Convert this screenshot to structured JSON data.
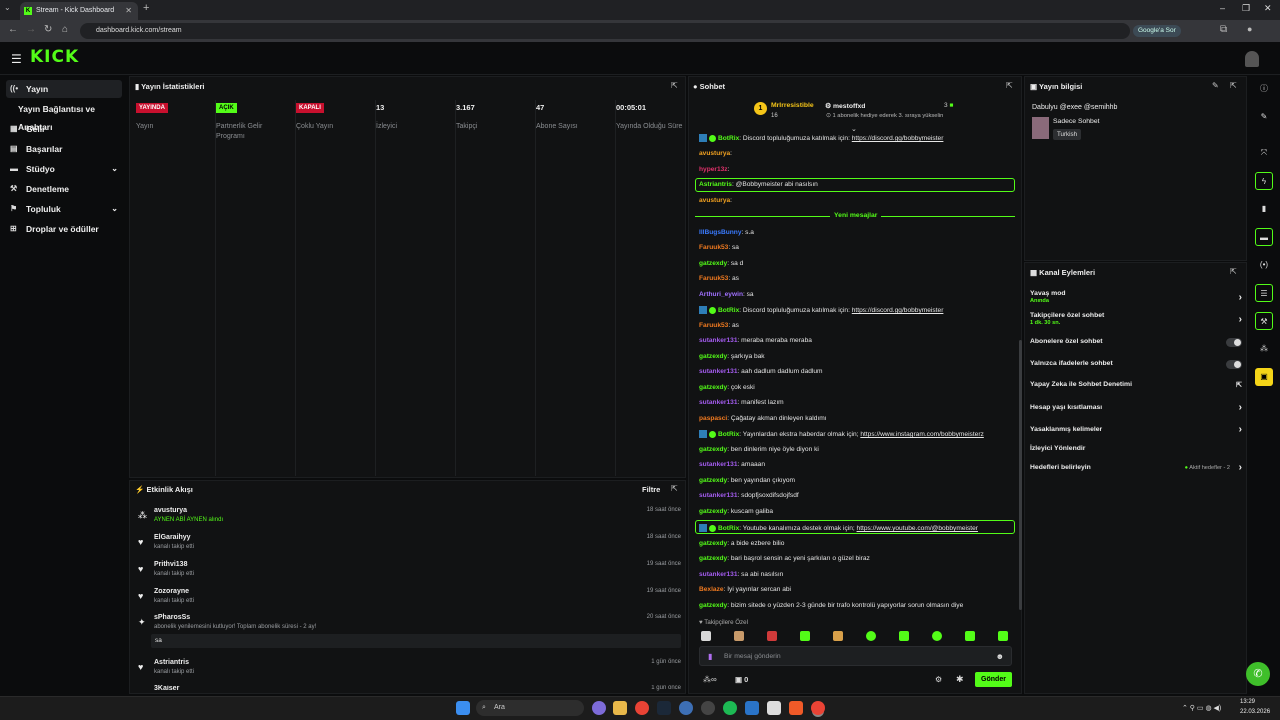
{
  "browser": {
    "tab_title": "Stream - Kick Dashboard",
    "url": "dashboard.kick.com/stream",
    "google_button": "Google'a Sor"
  },
  "app": {
    "logo": "KICK"
  },
  "sidebar": {
    "items": [
      {
        "label": "Yayın",
        "icon": "broadcast-icon"
      },
      {
        "label": "Yayın Bağlantısı ve Anahtarı",
        "icon": ""
      },
      {
        "label": "Gelir",
        "icon": "revenue-icon"
      },
      {
        "label": "Başarılar",
        "icon": "achievements-icon"
      },
      {
        "label": "Stüdyo",
        "icon": "studio-icon"
      },
      {
        "label": "Denetleme",
        "icon": "moderation-icon"
      },
      {
        "label": "Topluluk",
        "icon": "community-icon"
      },
      {
        "label": "Droplar ve ödüller",
        "icon": "drops-icon"
      }
    ]
  },
  "stats": {
    "title": "Yayın İstatistikleri",
    "items": [
      {
        "badge": "YAYINDA",
        "label": "Yayın",
        "color": "#c8102e"
      },
      {
        "badge": "AÇIK",
        "label": "Partnerlik Gelir Programı",
        "color": "#53fc18"
      },
      {
        "badge": "KAPALI",
        "label": "Çoklu Yayın",
        "color": "#c8102e"
      },
      {
        "value": "13",
        "label": "İzleyici"
      },
      {
        "value": "3.167",
        "label": "Takipçi"
      },
      {
        "value": "47",
        "label": "Abone Sayısı"
      },
      {
        "value": "00:05:01",
        "label": "Yayında Olduğu Süre"
      }
    ]
  },
  "activity": {
    "title": "Etkinlik Akışı",
    "filter": "Filtre",
    "items": [
      {
        "name": "avusturya",
        "sub": "AYNEN ABİ AYNEN alındı",
        "time": "18 saat önce"
      },
      {
        "name": "ElGaraihyy",
        "sub": "kanalı takip etti",
        "time": "18 saat önce"
      },
      {
        "name": "Prithvi138",
        "sub": "kanalı takip etti",
        "time": "19 saat önce"
      },
      {
        "name": "Zozorayne",
        "sub": "kanalı takip etti",
        "time": "19 saat önce"
      },
      {
        "name": "sPharosSs",
        "sub": "abonelik yenilemesini kutluyor! Toplam abonelik süresi - 2 ay!",
        "time": "20 saat önce",
        "msg": "sa"
      },
      {
        "name": "Astriantris",
        "sub": "kanalı takip etti",
        "time": "1 gün önce"
      },
      {
        "name": "3Kaiser",
        "sub": "",
        "time": "1 gün önce"
      }
    ]
  },
  "chat": {
    "title": "Sohbet",
    "pinned_user_1": "MrIrresistible",
    "pinned_count_1": "16",
    "pinned_user_2": "mestoffxd",
    "pinned_count_2": "3",
    "pinned_notice": "1 abonelik hediye ederek 3. sıraya yükselin",
    "new_messages": "Yeni mesajlar",
    "messages": [
      {
        "user": "BotRix",
        "color": "#53fc18",
        "text": ": Discord topluluğumuza katılmak için: ",
        "link": "https://discord.gg/bobbymeister"
      },
      {
        "user": "avusturya",
        "color": "#f0a020",
        "text": ":"
      },
      {
        "user": "hyper13z",
        "color": "#e0316b",
        "text": ":"
      },
      {
        "user": "Astriantris",
        "color": "#53fc18",
        "text": ": @Bobbymeister abi nasılsın"
      },
      {
        "user": "avusturya",
        "color": "#f0a020",
        "text": ":"
      },
      {
        "user": "IllBugsBunny",
        "color": "#3a7bff",
        "text": ": s.a"
      },
      {
        "user": "Faruuk53",
        "color": "#f07a20",
        "text": ": sa"
      },
      {
        "user": "gatzexdy",
        "color": "#53fc18",
        "text": ": sa d"
      },
      {
        "user": "Faruuk53",
        "color": "#f07a20",
        "text": ": as"
      },
      {
        "user": "Arthuri_eywin",
        "color": "#a070ff",
        "text": ": sa"
      },
      {
        "user": "BotRix",
        "color": "#53fc18",
        "text": ": Discord topluluğumuza katılmak için: ",
        "link": "https://discord.gg/bobbymeister"
      },
      {
        "user": "Faruuk53",
        "color": "#f07a20",
        "text": ": as"
      },
      {
        "user": "sutanker131",
        "color": "#a45cf0",
        "text": ": meraba meraba meraba"
      },
      {
        "user": "gatzexdy",
        "color": "#53fc18",
        "text": ": şarkıya bak"
      },
      {
        "user": "sutanker131",
        "color": "#a45cf0",
        "text": ": aah dadlum dadlum dadlum"
      },
      {
        "user": "gatzexdy",
        "color": "#53fc18",
        "text": ": çok eski"
      },
      {
        "user": "sutanker131",
        "color": "#a45cf0",
        "text": ": manifest lazım"
      },
      {
        "user": "paspasci",
        "color": "#f07a20",
        "text": ": Çağatay akman dinleyen kaldımı"
      },
      {
        "user": "BotRix",
        "color": "#53fc18",
        "text": ": Yayınlardan ekstra haberdar olmak için; ",
        "link": "https://www.instagram.com/bobbymeisterz"
      },
      {
        "user": "gatzexdy",
        "color": "#53fc18",
        "text": ": ben dinlerim niye öyle diyon ki"
      },
      {
        "user": "sutanker131",
        "color": "#a45cf0",
        "text": ": amaaan"
      },
      {
        "user": "gatzexdy",
        "color": "#53fc18",
        "text": ": ben yayından çıkıyom"
      },
      {
        "user": "sutanker131",
        "color": "#a45cf0",
        "text": ": sdopfjsoxdifsdojfsdf"
      },
      {
        "user": "gatzexdy",
        "color": "#53fc18",
        "text": ": kuscam galiba"
      },
      {
        "user": "BotRix",
        "color": "#53fc18",
        "text": ": Youtube kanalımıza destek olmak için; ",
        "link": "https://www.youtube.com/@bobbymeister"
      },
      {
        "user": "gatzexdy",
        "color": "#53fc18",
        "text": ": a bide ezbere bilio"
      },
      {
        "user": "gatzexdy",
        "color": "#53fc18",
        "text": ": bari başrol sensin ac yeni şarkıları o güzel biraz"
      },
      {
        "user": "sutanker131",
        "color": "#a45cf0",
        "text": ": sa abi nasılsın"
      },
      {
        "user": "Bexlaze",
        "color": "#f07a20",
        "text": ": İyi yayınlar sercan abi"
      },
      {
        "user": "gatzexdy",
        "color": "#53fc18",
        "text": ": bizim sitede o yüzden 2-3 günde bir trafo kontrolü yapıyorlar sorun olmasın diye"
      }
    ],
    "followers_only": "Takipçilere Özel",
    "input_placeholder": "Bir mesaj gönderin",
    "send": "Gönder",
    "counter": "0"
  },
  "stream_info": {
    "title": "Yayın bilgisi",
    "stream_title": "Dabulyu @exee @semihhb",
    "category": "Sadece Sohbet",
    "tag": "Turkish"
  },
  "channel_actions": {
    "title": "Kanal Eylemleri",
    "items": [
      {
        "label": "Yavaş mod",
        "sub": "Anında",
        "control": "chevron"
      },
      {
        "label": "Takipçilere özel sohbet",
        "sub": "1 dk. 30 sn.",
        "control": "chevron"
      },
      {
        "label": "Abonelere özel sohbet",
        "sub": "",
        "control": "toggle"
      },
      {
        "label": "Yalnızca ifadelerle sohbet",
        "sub": "",
        "control": "toggle"
      },
      {
        "label": "Yapay Zeka ile Sohbet Denetimi",
        "sub": "",
        "control": "external"
      },
      {
        "label": "Hesap yaşı kısıtlaması",
        "sub": "",
        "control": "chevron"
      },
      {
        "label": "Yasaklanmış kelimeler",
        "sub": "",
        "control": "chevron"
      },
      {
        "label": "İzleyici Yönlendir",
        "sub": "",
        "control": "none"
      },
      {
        "label": "Hedefleri belirleyin",
        "sub": "",
        "control": "chevron",
        "extra": "Aktif hedefler - 2"
      }
    ]
  },
  "taskbar": {
    "search": "Ara",
    "time": "13:29",
    "date": "22.03.2026"
  },
  "colors": {
    "accent": "#53fc18",
    "live": "#c8102e",
    "bg": "#0b0c0d"
  }
}
